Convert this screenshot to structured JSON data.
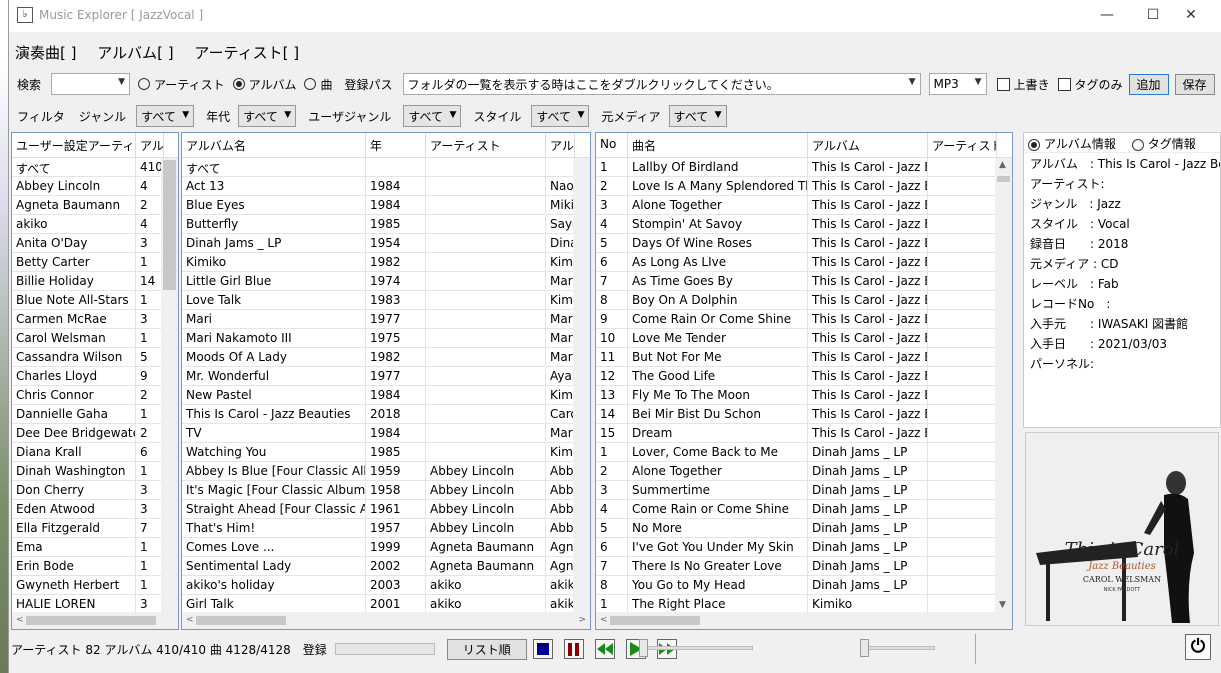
{
  "window": {
    "title": "Music Explorer [ JazzVocal ]",
    "icon_glyph": "♭",
    "minimize": "—",
    "maximize": "☐",
    "close": "✕"
  },
  "menu": [
    "演奏曲[  ]",
    "アルバム[  ]",
    "アーティスト[  ]"
  ],
  "search": {
    "label": "検索",
    "mode_artist": "アーティスト",
    "mode_album": "アルバム",
    "mode_track": "曲",
    "selected_mode": "アルバム",
    "register_path_label": "登録パス",
    "path_value": "フォルダの一覧を表示する時はここをダブルクリックしてください。",
    "format": "MP3",
    "overwrite_label": "上書き",
    "tag_only_label": "タグのみ",
    "add_button": "追加",
    "save_button": "保存"
  },
  "filters": {
    "filter_label": "フィルタ",
    "genre_label": "ジャンル",
    "genre_value": "すべて",
    "era_label": "年代",
    "era_value": "すべて",
    "user_genre_label": "ユーザジャンル",
    "user_genre_value": "すべて",
    "style_label": "スタイル",
    "style_value": "すべて",
    "media_label": "元メディア",
    "media_value": "すべて"
  },
  "artists_table": {
    "headers": [
      "ユーザー設定アーティスト",
      "アル"
    ],
    "rows": [
      [
        "すべて",
        "410"
      ],
      [
        "Abbey Lincoln",
        "4"
      ],
      [
        "Agneta Baumann",
        "2"
      ],
      [
        "akiko",
        "4"
      ],
      [
        "Anita O'Day",
        "3"
      ],
      [
        "Betty Carter",
        "1"
      ],
      [
        "Billie Holiday",
        "14"
      ],
      [
        "Blue Note All-Stars",
        "1"
      ],
      [
        "Carmen McRae",
        "3"
      ],
      [
        "Carol Welsman",
        "1"
      ],
      [
        "Cassandra Wilson",
        "5"
      ],
      [
        "Charles Lloyd",
        "9"
      ],
      [
        "Chris Connor",
        "2"
      ],
      [
        "Dannielle Gaha",
        "1"
      ],
      [
        "Dee Dee Bridgewater",
        "2"
      ],
      [
        "Diana Krall",
        "6"
      ],
      [
        "Dinah Washington",
        "1"
      ],
      [
        "Don Cherry",
        "3"
      ],
      [
        "Eden Atwood",
        "3"
      ],
      [
        "Ella Fitzgerald",
        "7"
      ],
      [
        "Ema",
        "1"
      ],
      [
        "Erin Bode",
        "1"
      ],
      [
        "Gwyneth Herbert",
        "1"
      ],
      [
        "HALIE LOREN",
        "3"
      ]
    ]
  },
  "albums_table": {
    "headers": [
      "アルバム名",
      "年",
      "アーティスト",
      "アル"
    ],
    "rows": [
      [
        "すべて",
        "",
        "",
        ""
      ],
      [
        "Act 13",
        "1984",
        "",
        "Naoi"
      ],
      [
        "Blue Eyes",
        "1984",
        "",
        "Miki"
      ],
      [
        "Butterfly",
        "1985",
        "",
        "Sayo"
      ],
      [
        "Dinah Jams _ LP",
        "1954",
        "",
        "Dina"
      ],
      [
        "Kimiko",
        "1982",
        "",
        "Kimil"
      ],
      [
        "Little Girl Blue",
        "1974",
        "",
        "Mari"
      ],
      [
        "Love Talk",
        "1983",
        "",
        "Kimil"
      ],
      [
        "Mari",
        "1977",
        "",
        "Mari"
      ],
      [
        "Mari Nakamoto III",
        "1975",
        "",
        "Mari"
      ],
      [
        "Moods Of A Lady",
        "1982",
        "",
        "Mari"
      ],
      [
        "Mr. Wonderful",
        "1977",
        "",
        "Ayak"
      ],
      [
        "New Pastel",
        "1984",
        "",
        "Kimil"
      ],
      [
        "This Is Carol - Jazz Beauties",
        "2018",
        "",
        "Caro"
      ],
      [
        "TV",
        "1984",
        "",
        "Mari"
      ],
      [
        "Watching You",
        "1985",
        "",
        "Kimil"
      ],
      [
        "Abbey Is Blue [Four Classic Albur",
        "1959",
        "Abbey Lincoln",
        "Abbe"
      ],
      [
        "It's Magic [Four Classic Albums]",
        "1958",
        "Abbey Lincoln",
        "Abbe"
      ],
      [
        "Straight Ahead [Four Classic Albu",
        "1961",
        "Abbey Lincoln",
        "Abbe"
      ],
      [
        "That's Him!",
        "1957",
        "Abbey Lincoln",
        "Abbe"
      ],
      [
        "Comes Love ...",
        "1999",
        "Agneta Baumann",
        "Agne"
      ],
      [
        "Sentimental Lady",
        "2002",
        "Agneta Baumann",
        "Agne"
      ],
      [
        "akiko's holiday",
        "2003",
        "akiko",
        "akiko"
      ],
      [
        "Girl Talk",
        "2001",
        "akiko",
        "akiko"
      ]
    ]
  },
  "tracks_table": {
    "headers": [
      "No",
      "曲名",
      "アルバム",
      "アーティスト"
    ],
    "rows": [
      [
        "1",
        "Lallby Of Birdland",
        "This Is Carol - Jazz Be",
        ""
      ],
      [
        "2",
        "Love Is A Many Splendored Thing",
        "This Is Carol - Jazz Be",
        ""
      ],
      [
        "3",
        "Alone Together",
        "This Is Carol - Jazz Be",
        ""
      ],
      [
        "4",
        "Stompin' At Savoy",
        "This Is Carol - Jazz Be",
        ""
      ],
      [
        "5",
        "Days Of Wine Roses",
        "This Is Carol - Jazz Be",
        ""
      ],
      [
        "6",
        "As Long As LIve",
        "This Is Carol - Jazz Be",
        ""
      ],
      [
        "7",
        "As Time Goes By",
        "This Is Carol - Jazz Be",
        ""
      ],
      [
        "8",
        "Boy On A Dolphin",
        "This Is Carol - Jazz Be",
        ""
      ],
      [
        "9",
        "Come Rain Or Come Shine",
        "This Is Carol - Jazz Be",
        ""
      ],
      [
        "10",
        "Love Me Tender",
        "This Is Carol - Jazz Be",
        ""
      ],
      [
        "11",
        "But Not For Me",
        "This Is Carol - Jazz Be",
        ""
      ],
      [
        "12",
        "The Good Life",
        "This Is Carol - Jazz Be",
        ""
      ],
      [
        "13",
        "Fly Me To The Moon",
        "This Is Carol - Jazz Be",
        ""
      ],
      [
        "14",
        "Bei Mir Bist Du Schon",
        "This Is Carol - Jazz Be",
        ""
      ],
      [
        "15",
        "Dream",
        "This Is Carol - Jazz Be",
        ""
      ],
      [
        "1",
        "Lover, Come Back to Me",
        "Dinah Jams _ LP",
        ""
      ],
      [
        "2",
        "Alone Together",
        "Dinah Jams _ LP",
        ""
      ],
      [
        "3",
        "Summertime",
        "Dinah Jams _ LP",
        ""
      ],
      [
        "4",
        "Come Rain or Come Shine",
        "Dinah Jams _ LP",
        ""
      ],
      [
        "5",
        "No More",
        "Dinah Jams _ LP",
        ""
      ],
      [
        "6",
        "I've Got You Under My Skin",
        "Dinah Jams _ LP",
        ""
      ],
      [
        "7",
        "There Is No Greater Love",
        "Dinah Jams _ LP",
        ""
      ],
      [
        "8",
        "You Go to My Head",
        "Dinah Jams _ LP",
        ""
      ],
      [
        "1",
        "The Right Place",
        "Kimiko",
        ""
      ]
    ]
  },
  "info_panel": {
    "opt_album": "アルバム情報",
    "opt_tag": "タグ情報",
    "lines": [
      "アルバム　: This Is Carol - Jazz Beauties",
      "アーティスト:",
      "ジャンル　: Jazz",
      "スタイル　: Vocal",
      "録音日　　: 2018",
      "元メディア : CD",
      "レーベル　: Fab",
      "レコードNo　:",
      "入手元　　: IWASAKI 図書館",
      "入手日　　: 2021/03/03",
      "パーソネル:"
    ]
  },
  "cover": {
    "title": "This is Carol",
    "subtitle": "Jazz Beauties",
    "artist": "CAROL WELSMAN",
    "featuring": "NICK FARDOTT"
  },
  "status": {
    "counts": "アーティスト 82 アルバム 410/410 曲 4128/4128",
    "register_label": "登録",
    "list_order_button": "リスト順",
    "stop_color": "#00008b",
    "pause_color": "#8b0000",
    "play_color": "#1a8a1a",
    "power_icon": "⏻"
  }
}
